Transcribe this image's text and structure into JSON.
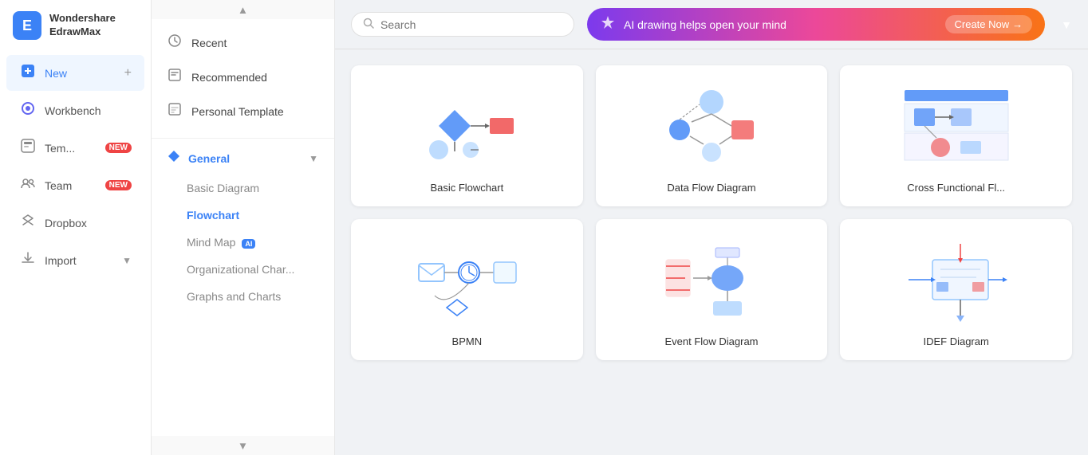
{
  "app": {
    "name": "Wondershare",
    "subtitle": "EdrawMax",
    "logo_letter": "E"
  },
  "sidebar": {
    "items": [
      {
        "id": "new",
        "label": "New",
        "icon": "➕",
        "badge": null,
        "has_plus": true
      },
      {
        "id": "workbench",
        "label": "Workbench",
        "icon": "🔷",
        "badge": null,
        "has_plus": false
      },
      {
        "id": "templates",
        "label": "Tem...",
        "icon": "💬",
        "badge": "NEW",
        "has_plus": false
      },
      {
        "id": "team",
        "label": "Team",
        "icon": "👥",
        "badge": "NEW",
        "has_plus": false
      },
      {
        "id": "dropbox",
        "label": "Dropbox",
        "icon": "📦",
        "badge": null,
        "has_plus": false
      },
      {
        "id": "import",
        "label": "Import",
        "icon": "⬇️",
        "badge": null,
        "has_plus": false
      }
    ]
  },
  "middle_panel": {
    "menu_items": [
      {
        "id": "recent",
        "label": "Recent",
        "icon": "🕐"
      },
      {
        "id": "recommended",
        "label": "Recommended",
        "icon": "📋"
      },
      {
        "id": "personal_template",
        "label": "Personal Template",
        "icon": "📄"
      }
    ],
    "categories": [
      {
        "id": "general",
        "label": "General",
        "icon": "🔷",
        "expanded": true,
        "sub_items": [
          {
            "id": "basic_diagram",
            "label": "Basic Diagram",
            "active": false
          },
          {
            "id": "flowchart",
            "label": "Flowchart",
            "active": true
          },
          {
            "id": "mind_map",
            "label": "Mind Map",
            "ai": true,
            "active": false
          },
          {
            "id": "org_chart",
            "label": "Organizational Char...",
            "active": false
          },
          {
            "id": "graphs",
            "label": "Graphs and Charts",
            "active": false
          }
        ]
      }
    ]
  },
  "search": {
    "placeholder": "Search"
  },
  "ai_banner": {
    "text": "AI drawing helps open your mind",
    "button_label": "Create Now",
    "arrow": "→"
  },
  "cards": [
    {
      "id": "basic_flowchart",
      "label": "Basic Flowchart",
      "type": "flowchart1"
    },
    {
      "id": "data_flow_diagram",
      "label": "Data Flow Diagram",
      "type": "dataflow"
    },
    {
      "id": "cross_functional",
      "label": "Cross Functional Fl...",
      "type": "crossfunctional"
    },
    {
      "id": "bpmn",
      "label": "BPMN",
      "type": "bpmn"
    },
    {
      "id": "event_flow",
      "label": "Event Flow Diagram",
      "type": "eventflow"
    },
    {
      "id": "idef",
      "label": "IDEF Diagram",
      "type": "idef"
    }
  ],
  "colors": {
    "accent": "#3b82f6",
    "badge_red": "#ef4444",
    "banner_start": "#7c3aed",
    "banner_end": "#f97316"
  }
}
